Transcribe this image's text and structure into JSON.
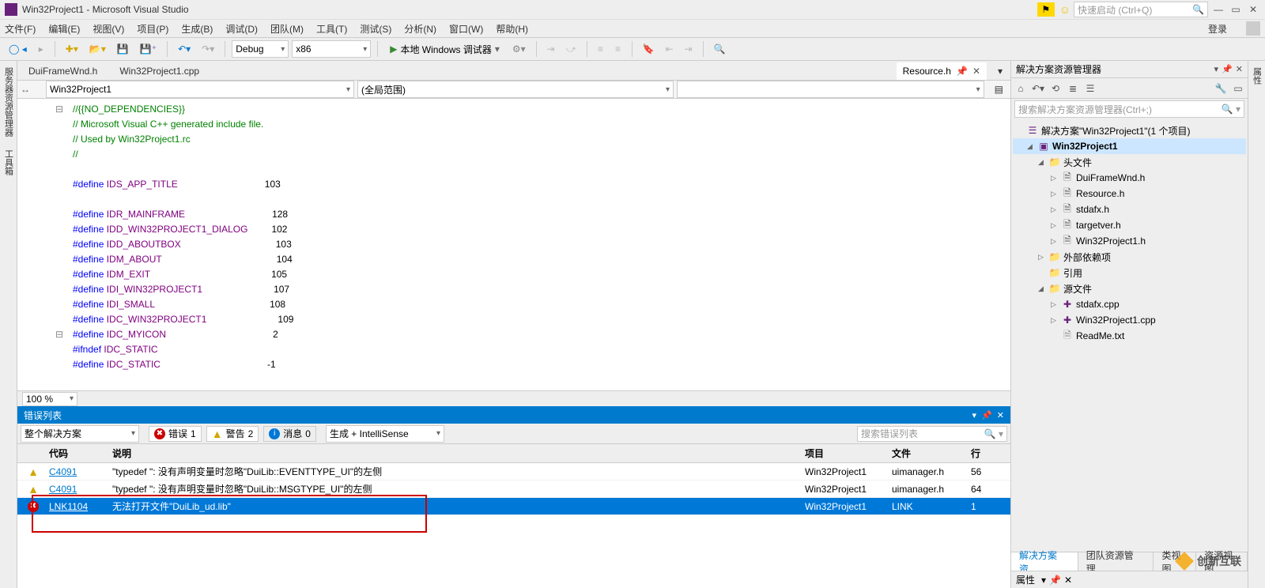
{
  "titlebar": {
    "title": "Win32Project1 - Microsoft Visual Studio",
    "quick_launch": "快速启动 (Ctrl+Q)"
  },
  "menu": {
    "file": "文件(F)",
    "edit": "编辑(E)",
    "view": "视图(V)",
    "project": "项目(P)",
    "build": "生成(B)",
    "debug": "调试(D)",
    "team": "团队(M)",
    "tools": "工具(T)",
    "test": "测试(S)",
    "analyze": "分析(N)",
    "window": "窗口(W)",
    "help": "帮助(H)",
    "login": "登录"
  },
  "toolbar": {
    "config": "Debug",
    "platform": "x86",
    "start": "本地 Windows 调试器"
  },
  "left_tabs": {
    "server": "服务器资源管理器",
    "toolbox": "工具箱"
  },
  "right_strip": {
    "props": "属性"
  },
  "doc_tabs": {
    "t1": "DuiFrameWnd.h",
    "t2": "Win32Project1.cpp",
    "active": "Resource.h"
  },
  "nav": {
    "scope": "Win32Project1",
    "area": "(全局范围)"
  },
  "code": {
    "l1": "//{{NO_DEPENDENCIES}}",
    "l2": "// Microsoft Visual C++ generated include file.",
    "l3": "// Used by Win32Project1.rc",
    "l4": "//",
    "l5a": "#define",
    "l5b": "IDS_APP_TITLE",
    "l5c": "103",
    "l6a": "#define",
    "l6b": "IDR_MAINFRAME",
    "l6c": "128",
    "l7a": "#define",
    "l7b": "IDD_WIN32PROJECT1_DIALOG",
    "l7c": "102",
    "l8a": "#define",
    "l8b": "IDD_ABOUTBOX",
    "l8c": "103",
    "l9a": "#define",
    "l9b": "IDM_ABOUT",
    "l9c": "104",
    "l10a": "#define",
    "l10b": "IDM_EXIT",
    "l10c": "105",
    "l11a": "#define",
    "l11b": "IDI_WIN32PROJECT1",
    "l11c": "107",
    "l12a": "#define",
    "l12b": "IDI_SMALL",
    "l12c": "108",
    "l13a": "#define",
    "l13b": "IDC_WIN32PROJECT1",
    "l13c": "109",
    "l14a": "#define",
    "l14b": "IDC_MYICON",
    "l14c": "2",
    "l15a": "#ifndef",
    "l15b": "IDC_STATIC",
    "l16a": "#define",
    "l16b": "IDC_STATIC",
    "l16c": "-1"
  },
  "zoom": "100 %",
  "err_panel": {
    "title": "错误列表",
    "scope": "整个解决方案",
    "errors_label": "错误",
    "errors_n": "1",
    "warnings_label": "警告",
    "warnings_n": "2",
    "messages_label": "消息",
    "messages_n": "0",
    "filter": "生成 + IntelliSense",
    "search": "搜索错误列表",
    "h_blank": "",
    "h_code": "代码",
    "h_desc": "说明",
    "h_proj": "项目",
    "h_file": "文件",
    "h_line": "行",
    "rows": [
      {
        "type": "warn",
        "code": "C4091",
        "desc": "\"typedef \": 没有声明变量时忽略\"DuiLib::EVENTTYPE_UI\"的左侧",
        "proj": "Win32Project1",
        "file": "uimanager.h",
        "line": "56"
      },
      {
        "type": "warn",
        "code": "C4091",
        "desc": "\"typedef \": 没有声明变量时忽略\"DuiLib::MSGTYPE_UI\"的左侧",
        "proj": "Win32Project1",
        "file": "uimanager.h",
        "line": "64"
      },
      {
        "type": "err",
        "code": "LNK1104",
        "desc": "无法打开文件\"DuiLib_ud.lib\"",
        "proj": "Win32Project1",
        "file": "LINK",
        "line": "1"
      }
    ]
  },
  "solution": {
    "panel_title": "解决方案资源管理器",
    "search": "搜索解决方案资源管理器(Ctrl+;)",
    "root": "解决方案\"Win32Project1\"(1 个项目)",
    "project": "Win32Project1",
    "headers": "头文件",
    "h1": "DuiFrameWnd.h",
    "h2": "Resource.h",
    "h3": "stdafx.h",
    "h4": "targetver.h",
    "h5": "Win32Project1.h",
    "extdep": "外部依赖项",
    "refs": "引用",
    "sources": "源文件",
    "s1": "stdafx.cpp",
    "s2": "Win32Project1.cpp",
    "readme": "ReadMe.txt"
  },
  "bottom_tabs": {
    "b1": "解决方案资...",
    "b2": "团队资源管理...",
    "b3": "类视图",
    "b4": "资源视图"
  },
  "properties_title": "属性",
  "watermark": "创新互联"
}
